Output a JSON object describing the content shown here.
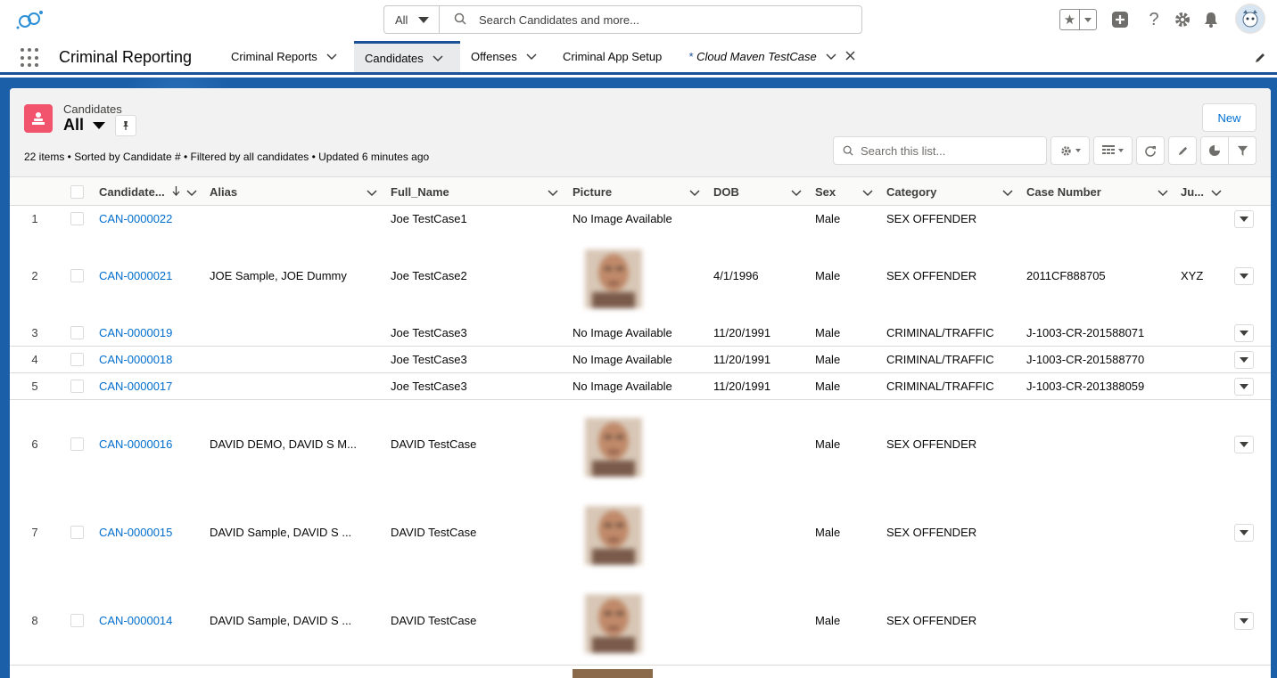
{
  "header": {
    "search_scope": "All",
    "search_placeholder": "Search Candidates and more..."
  },
  "nav": {
    "app_name": "Criminal Reporting",
    "tabs": [
      {
        "label": "Criminal Reports"
      },
      {
        "label": "Candidates"
      },
      {
        "label": "Offenses"
      },
      {
        "label": "Criminal App Setup"
      },
      {
        "label": "Cloud Maven TestCase",
        "prefix": "*"
      }
    ]
  },
  "list": {
    "object_label": "Candidates",
    "view_name": "All",
    "new_label": "New",
    "summary": "22 items • Sorted by Candidate # • Filtered by all candidates • Updated 6 minutes ago",
    "search_placeholder": "Search this list..."
  },
  "columns": {
    "candidate": "Candidate...",
    "alias": "Alias",
    "full_name": "Full_Name",
    "picture": "Picture",
    "dob": "DOB",
    "sex": "Sex",
    "category": "Category",
    "case_number": "Case Number",
    "jurisdiction": "Ju..."
  },
  "rows": [
    {
      "num": "1",
      "id": "CAN-0000022",
      "alias": "",
      "full_name": "Joe TestCase1",
      "picture": "No Image Available",
      "dob": "",
      "sex": "Male",
      "category": "SEX OFFENDER",
      "case": "",
      "ju": ""
    },
    {
      "num": "2",
      "id": "CAN-0000021",
      "alias": "JOE Sample, JOE Dummy",
      "full_name": "Joe TestCase2",
      "picture": "",
      "dob": "4/1/1996",
      "sex": "Male",
      "category": "SEX OFFENDER",
      "case": "2011CF888705",
      "ju": "XYZ"
    },
    {
      "num": "3",
      "id": "CAN-0000019",
      "alias": "",
      "full_name": "Joe TestCase3",
      "picture": "No Image Available",
      "dob": "11/20/1991",
      "sex": "Male",
      "category": "CRIMINAL/TRAFFIC",
      "case": "J-1003-CR-201588071",
      "ju": ""
    },
    {
      "num": "4",
      "id": "CAN-0000018",
      "alias": "",
      "full_name": "Joe TestCase3",
      "picture": "No Image Available",
      "dob": "11/20/1991",
      "sex": "Male",
      "category": "CRIMINAL/TRAFFIC",
      "case": "J-1003-CR-201588770",
      "ju": ""
    },
    {
      "num": "5",
      "id": "CAN-0000017",
      "alias": "",
      "full_name": "Joe TestCase3",
      "picture": "No Image Available",
      "dob": "11/20/1991",
      "sex": "Male",
      "category": "CRIMINAL/TRAFFIC",
      "case": "J-1003-CR-201388059",
      "ju": ""
    },
    {
      "num": "6",
      "id": "CAN-0000016",
      "alias": "DAVID DEMO, DAVID S M...",
      "full_name": "DAVID TestCase",
      "picture": "",
      "dob": "",
      "sex": "Male",
      "category": "SEX OFFENDER",
      "case": "",
      "ju": ""
    },
    {
      "num": "7",
      "id": "CAN-0000015",
      "alias": "DAVID Sample, DAVID S ...",
      "full_name": "DAVID TestCase",
      "picture": "",
      "dob": "",
      "sex": "Male",
      "category": "SEX OFFENDER",
      "case": "",
      "ju": ""
    },
    {
      "num": "8",
      "id": "CAN-0000014",
      "alias": "DAVID Sample, DAVID S ...",
      "full_name": "DAVID TestCase",
      "picture": "",
      "dob": "",
      "sex": "Male",
      "category": "SEX OFFENDER",
      "case": "",
      "ju": ""
    }
  ]
}
